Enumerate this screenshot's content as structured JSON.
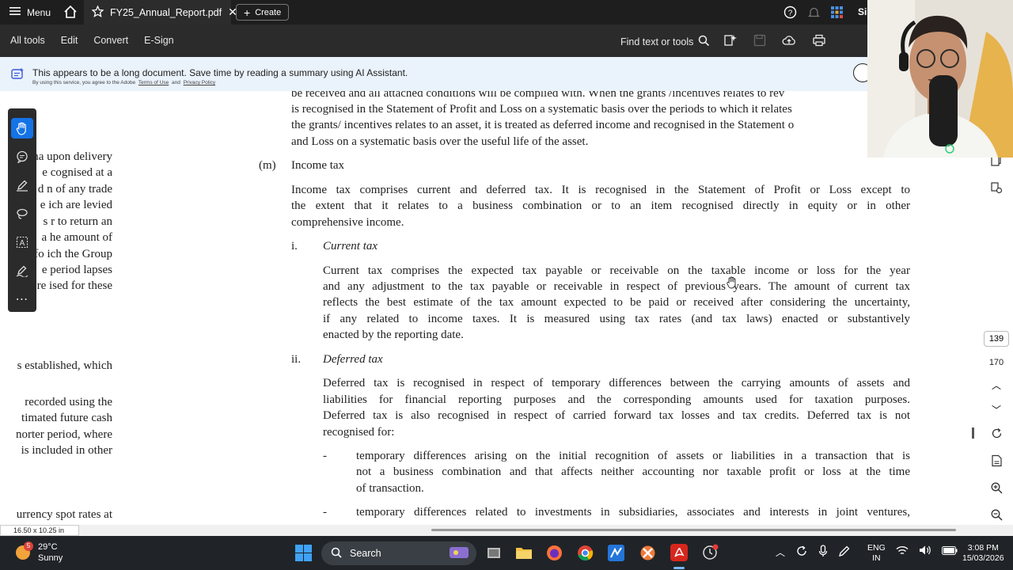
{
  "titlebar": {
    "menu_label": "Menu",
    "tab_name": "FY25_Annual_Report.pdf",
    "create_label": "Create",
    "signin_label": "Si"
  },
  "toolbar": {
    "all_tools": "All tools",
    "edit": "Edit",
    "convert": "Convert",
    "esign": "E-Sign",
    "find_label": "Find text or tools"
  },
  "banner": {
    "message": "This appears to be a long document. Save time by reading a summary using AI Assistant.",
    "consent_prefix": "By using this service, you agree to the Adobe",
    "terms": "Terms of Use",
    "and": "and",
    "privacy": "Privacy Policy"
  },
  "doc": {
    "top_lines": [
      "be received and all attached conditions will be complied with. When the grants /incentives relates to rev",
      "is recognised in the Statement of Profit and Loss on a systematic basis over the periods to which it relates",
      "the grants/ incentives relates to an asset, it is treated as deferred income and recognised in the Statement o",
      "and Loss on a systematic basis over the useful life of the asset."
    ],
    "section_m_label": "(m)",
    "section_m_title": "Income tax",
    "income_tax_para": [
      "Income tax comprises current and deferred tax. It is recognised in the Statement of Profit or Loss except to",
      "the extent that it relates to a business combination or to an item recognised directly in equity or in other",
      "comprehensive income."
    ],
    "sub_i_label": "i.",
    "sub_i_title": "Current tax",
    "current_tax_para": [
      "Current tax comprises the expected tax payable or receivable on the taxable income or loss for the year",
      "and any adjustment to the tax payable or receivable in respect of previous years. The amount of current tax",
      "reflects the best estimate of the tax amount expected to be paid or received after considering the uncertainty,",
      "if any related to income taxes. It is measured using tax rates (and tax laws) enacted or substantively",
      "enacted by the reporting date."
    ],
    "sub_ii_label": "ii.",
    "sub_ii_title": "Deferred tax",
    "deferred_tax_para": [
      "Deferred tax is recognised in respect of temporary differences between the carrying amounts of assets and",
      "liabilities for financial reporting purposes and the corresponding amounts used for taxation purposes.",
      "Deferred tax is also recognised in respect of carried forward tax losses and tax credits. Deferred tax is not",
      "recognised for:"
    ],
    "bullet_dash": "-",
    "bullet1": [
      "temporary differences arising on the initial recognition of assets or liabilities in a transaction that is",
      "not a business combination and that affects neither accounting nor taxable profit or loss at the time",
      "of transaction."
    ],
    "bullet2": [
      "temporary differences related to investments in subsidiaries, associates and interests in joint ventures,"
    ],
    "left_column": [
      "na   upon delivery",
      "e   cognised at a",
      "d   n of any trade",
      "e   ich are levied",
      "s   r to return an",
      "a   he amount of",
      "fo   ich the Group",
      "e   period lapses",
      "re   ised for these",
      "s established, which",
      "recorded using the",
      "timated future cash",
      "norter period, where",
      "is included in other",
      "urrency spot rates at"
    ]
  },
  "right_rail": {
    "page_current": "139",
    "page_total": "170"
  },
  "statusbar": {
    "page_size": "16.50 x 10.25 in"
  },
  "taskbar": {
    "weather_badge": "5",
    "temperature": "29°C",
    "condition": "Sunny",
    "search_label": "Search",
    "lang_top": "ENG",
    "lang_bottom": "IN",
    "time": "3:08 PM",
    "date": "15/03/2026"
  },
  "colors": {
    "accent": "#1473e6",
    "acrobat_red": "#d7261e"
  }
}
